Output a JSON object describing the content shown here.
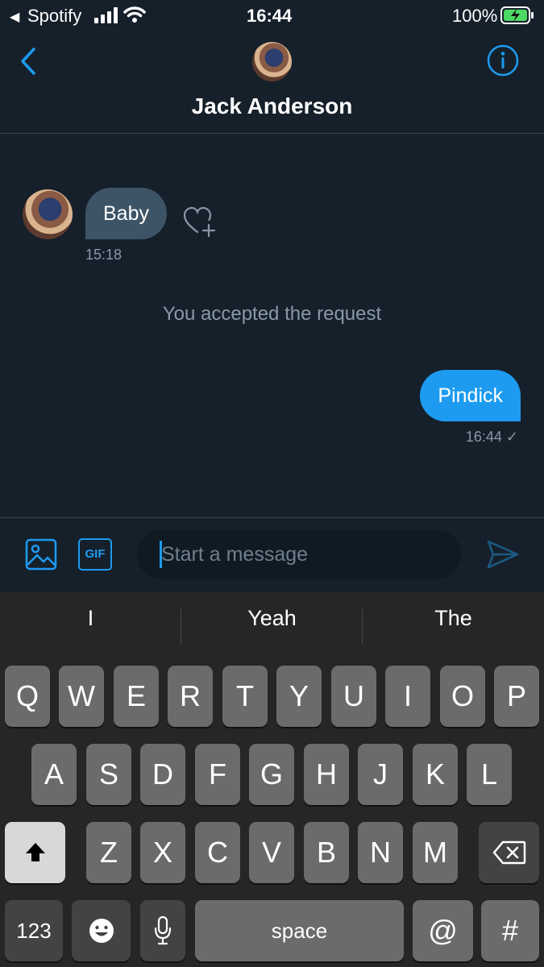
{
  "status_bar": {
    "back_app": "Spotify",
    "time": "16:44",
    "battery": "100%"
  },
  "header": {
    "contact_name": "Jack Anderson"
  },
  "messages": [
    {
      "direction": "incoming",
      "text": "Baby",
      "time": "15:18"
    },
    {
      "direction": "system",
      "text": "You accepted the request"
    },
    {
      "direction": "outgoing",
      "text": "Pindick",
      "time": "16:44",
      "read_mark": "✓"
    }
  ],
  "composer": {
    "placeholder": "Start a message",
    "gif_label": "GIF"
  },
  "keyboard": {
    "suggestions": [
      "I",
      "Yeah",
      "The"
    ],
    "row1": [
      "Q",
      "W",
      "E",
      "R",
      "T",
      "Y",
      "U",
      "I",
      "O",
      "P"
    ],
    "row2": [
      "A",
      "S",
      "D",
      "F",
      "G",
      "H",
      "J",
      "K",
      "L"
    ],
    "row3": [
      "Z",
      "X",
      "C",
      "V",
      "B",
      "N",
      "M"
    ],
    "numbers_label": "123",
    "space_label": "space",
    "at_label": "@",
    "hash_label": "#"
  },
  "colors": {
    "background": "#15202b",
    "accent": "#1d9bf0",
    "incoming_bubble": "#3d5466",
    "muted_text": "#8899a6"
  }
}
